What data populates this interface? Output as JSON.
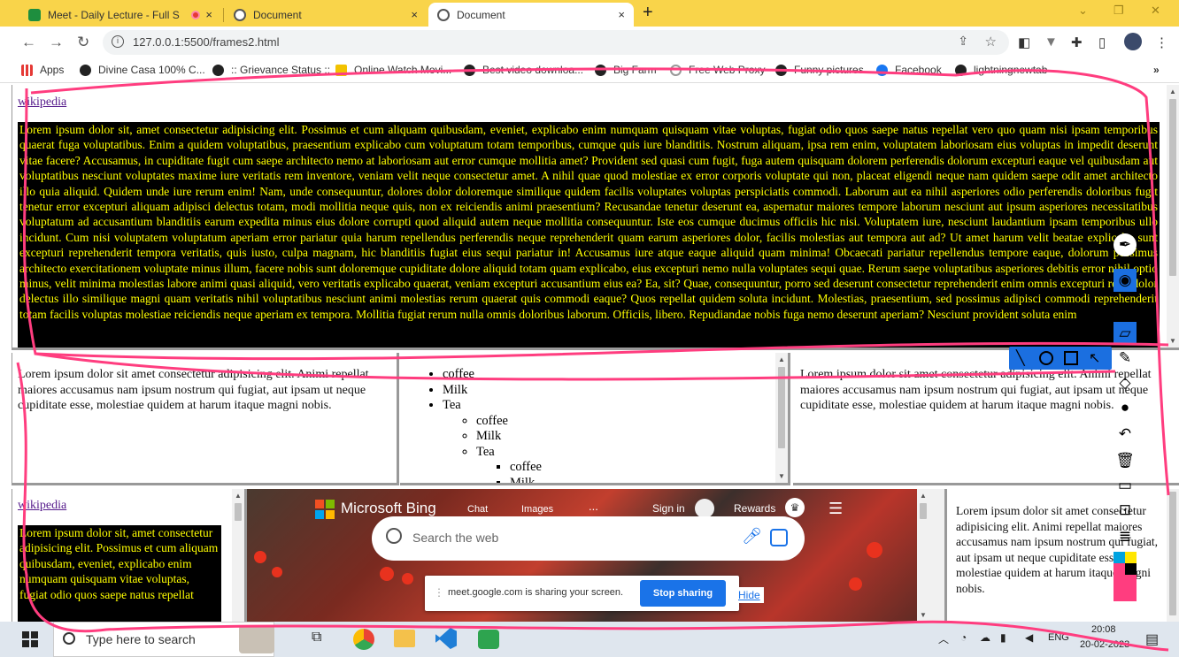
{
  "browser": {
    "tabs": [
      {
        "title": "Meet - Daily Lecture - Full S",
        "active": false,
        "recording": true
      },
      {
        "title": "Document",
        "active": false
      },
      {
        "title": "Document",
        "active": true
      }
    ],
    "new_tab": "+",
    "close_glyph": "×",
    "url": "127.0.0.1:5500/frames2.html",
    "bookmarks": [
      {
        "label": "Apps",
        "icon": "apps-grid-icon"
      },
      {
        "label": "Divine Casa 100% C...",
        "icon": "globe-icon"
      },
      {
        "label": ":: Grievance Status ::",
        "icon": "globe-icon"
      },
      {
        "label": "Online Watch Movi...",
        "icon": "film-icon"
      },
      {
        "label": "Best video downloa...",
        "icon": "globe-icon"
      },
      {
        "label": "Big Farm",
        "icon": "globe-icon"
      },
      {
        "label": "Free Web Proxy",
        "icon": "search-icon"
      },
      {
        "label": "Funny pictures",
        "icon": "globe-icon"
      },
      {
        "label": "Facebook",
        "icon": "facebook-icon"
      },
      {
        "label": "lightningnewtab",
        "icon": "globe-icon"
      }
    ],
    "bookmarks_more": "»"
  },
  "frames": {
    "top": {
      "link": "wikipedia",
      "text": "Lorem ipsum dolor sit, amet consectetur adipisicing elit. Possimus et cum aliquam quibusdam, eveniet, explicabo enim numquam quisquam vitae voluptas, fugiat odio quos saepe natus repellat vero quo quam nisi ipsam temporibus quaerat fuga voluptatibus. Enim a quidem voluptatibus, praesentium explicabo cum voluptatum totam temporibus, cumque quis iure blanditiis. Nostrum aliquam, ipsa rem enim, voluptatem laboriosam eius voluptas in impedit deserunt vitae facere? Accusamus, in cupiditate fugit cum saepe architecto nemo at laboriosam aut error cumque mollitia amet? Provident sed quasi cum fugit, fuga autem quisquam dolorem perferendis dolorum excepturi eaque vel quibusdam aut voluptatibus nesciunt voluptates maxime iure veritatis rem inventore, veniam velit neque consectetur amet. A nihil quae quod molestiae ex error corporis voluptate qui non, placeat eligendi neque nam quidem saepe odit amet architecto illo quia aliquid. Quidem unde iure rerum enim! Nam, unde consequuntur, dolores dolor doloremque similique quidem facilis voluptates voluptas perspiciatis commodi. Laborum aut ea nihil asperiores odio perferendis doloribus fugit tenetur error excepturi aliquam adipisci delectus totam, modi mollitia neque quis, non ex reiciendis animi praesentium? Recusandae tenetur deserunt ea, aspernatur maiores tempore laborum nesciunt aut ipsum asperiores necessitatibus voluptatum ad accusantium blanditiis earum expedita minus eius dolore corrupti quod aliquid autem neque mollitia consequuntur. Iste eos cumque ducimus officiis hic nisi. Voluptatem iure, nesciunt laudantium ipsam temporibus ullo incidunt. Cum nisi voluptatem voluptatum aperiam error pariatur quia harum repellendus perferendis neque reprehenderit quam earum asperiores dolor, facilis molestias aut tempora aut ad? Ut amet harum velit beatae explicabo sunt excepturi reprehenderit tempora veritatis, quis iusto, culpa magnam, hic blanditiis fugiat eius sequi pariatur in! Accusamus iure atque eaque aliquid quam minima! Obcaecati pariatur repellendus tempore eaque, dolorum possimus architecto exercitationem voluptate minus illum, facere nobis sunt doloremque cupiditate dolore aliquid totam quam explicabo, eius excepturi nemo nulla voluptates sequi quae. Rerum saepe voluptatibus asperiores debitis error nihil optio minus, velit minima molestias labore animi quasi aliquid, vero veritatis explicabo quaerat, veniam excepturi accusantium eius ea? Ea, sit? Quae, consequuntur, porro sed deserunt consectetur reprehenderit enim omnis excepturi rem, dolor delectus illo similique magni quam veritatis nihil voluptatibus nesciunt animi molestias rerum quaerat quis commodi eaque? Quos repellat quidem soluta incidunt. Molestias, praesentium, sed possimus adipisci commodi reprehenderit totam facilis voluptas molestiae reiciendis neque aperiam ex tempora. Mollitia fugiat rerum nulla omnis doloribus laborum. Officiis, libero. Repudiandae nobis fuga nemo deserunt aperiam? Nesciunt provident soluta enim"
    },
    "mid_left": {
      "text": "Lorem ipsum dolor sit amet consectetur adipisicing elit. Animi repellat maiores accusamus nam ipsum nostrum qui fugiat, aut ipsam ut neque cupiditate esse, molestiae quidem at harum itaque magni nobis."
    },
    "mid_center": {
      "list": [
        "coffee",
        "Milk",
        "Tea"
      ],
      "sub_list": [
        "coffee",
        "Milk",
        "Tea"
      ],
      "sub_sub_list": [
        "coffee",
        "Milk"
      ]
    },
    "mid_right": {
      "text": "Lorem ipsum dolor sit amet consectetur adipisicing elit. Animi repellat maiores accusamus nam ipsum nostrum qui fugiat, aut ipsam ut neque cupiditate esse, molestiae quidem at harum itaque magni nobis."
    },
    "bottom_left": {
      "link": "wikipedia",
      "text": "Lorem ipsum dolor sit, amet consectetur adipisicing elit. Possimus et cum aliquam quibusdam, eveniet, explicabo enim numquam quisquam vitae voluptas, fugiat odio quos saepe natus repellat"
    },
    "bing": {
      "brand": "Microsoft Bing",
      "nav": [
        "Chat",
        "Images",
        "..."
      ],
      "sign_in": "Sign in",
      "rewards": "Rewards",
      "search_placeholder": "Search the web"
    },
    "bottom_right": {
      "text": "Lorem ipsum dolor sit amet consectetur adipisicing elit. Animi repellat maiores accusamus nam ipsum nostrum qui fugiat, aut ipsam ut neque cupiditate esse, molestiae quidem at harum itaque magni nobis."
    }
  },
  "share_banner": {
    "message": "meet.google.com is sharing your screen.",
    "stop_label": "Stop sharing",
    "hide_label": "Hide"
  },
  "taskbar": {
    "search_placeholder": "Type here to search",
    "lang": "ENG",
    "time": "20:08",
    "date": "20-02-2023"
  },
  "colors": {
    "tabstrip": "#f9d44a",
    "annotation_ink": "#ff3d7f",
    "stop_button": "#1a73e8"
  }
}
